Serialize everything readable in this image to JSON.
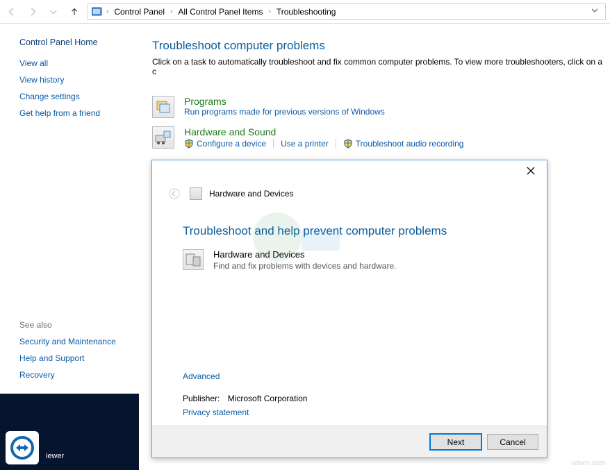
{
  "breadcrumb": {
    "items": [
      "Control Panel",
      "All Control Panel Items",
      "Troubleshooting"
    ]
  },
  "sidebar": {
    "home": "Control Panel Home",
    "links": [
      "View all",
      "View history",
      "Change settings",
      "Get help from a friend"
    ],
    "see_also_title": "See also",
    "see_also": [
      "Security and Maintenance",
      "Help and Support",
      "Recovery"
    ]
  },
  "page": {
    "heading": "Troubleshoot computer problems",
    "sub": "Click on a task to automatically troubleshoot and fix common computer problems. To view more troubleshooters, click on a c"
  },
  "categories": [
    {
      "title": "Programs",
      "desc": "Run programs made for previous versions of Windows",
      "links": []
    },
    {
      "title": "Hardware and Sound",
      "desc": "",
      "links": [
        "Configure a device",
        "Use a printer",
        "Troubleshoot audio recording"
      ]
    }
  ],
  "dialog": {
    "name": "Hardware and Devices",
    "heading": "Troubleshoot and help prevent computer problems",
    "item_title": "Hardware and Devices",
    "item_desc": "Find and fix problems with devices and hardware.",
    "advanced": "Advanced",
    "publisher_label": "Publisher:",
    "publisher": "Microsoft Corporation",
    "privacy": "Privacy statement",
    "next": "Next",
    "cancel": "Cancel"
  },
  "taskbar": {
    "viewer": "iewer"
  },
  "watermark": "wsxn.com"
}
